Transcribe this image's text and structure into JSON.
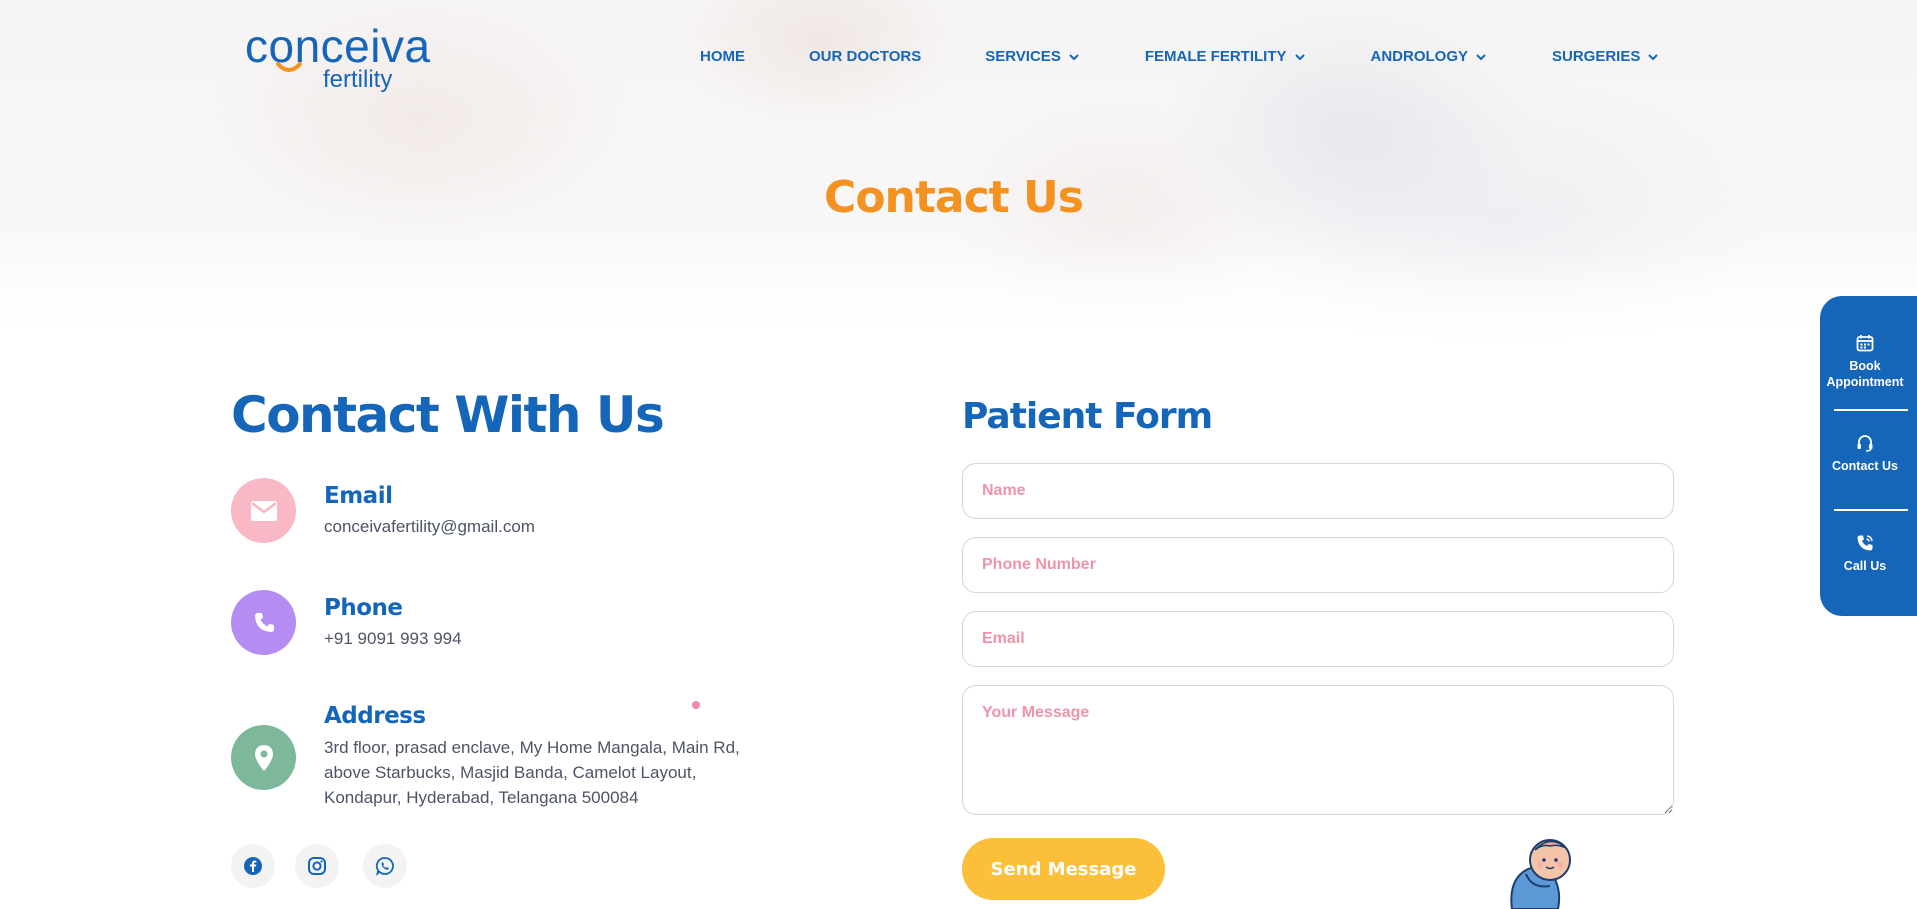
{
  "logo": {
    "main": "conceiva",
    "sub": "fertility"
  },
  "nav": {
    "items": [
      {
        "label": "HOME",
        "dropdown": false
      },
      {
        "label": "OUR DOCTORS",
        "dropdown": false
      },
      {
        "label": "SERVICES",
        "dropdown": true
      },
      {
        "label": "FEMALE FERTILITY",
        "dropdown": true
      },
      {
        "label": "ANDROLOGY",
        "dropdown": true
      },
      {
        "label": "SURGERIES",
        "dropdown": true
      }
    ]
  },
  "hero": {
    "title": "Contact Us"
  },
  "contact": {
    "title": "Contact With Us",
    "email": {
      "label": "Email",
      "value": "conceivafertility@gmail.com",
      "icon": "mail-icon"
    },
    "phone": {
      "label": "Phone",
      "value": "+91 9091 993 994",
      "icon": "phone-icon"
    },
    "address": {
      "label": "Address",
      "lines": [
        "3rd floor, prasad enclave, My Home Mangala, Main Rd,",
        "above Starbucks, Masjid Banda, Camelot Layout,",
        "Kondapur, Hyderabad, Telangana 500084"
      ],
      "icon": "location-pin-icon"
    },
    "socials": [
      "facebook-icon",
      "instagram-icon",
      "whatsapp-icon"
    ]
  },
  "form": {
    "title": "Patient Form",
    "name_placeholder": "Name",
    "phone_placeholder": "Phone Number",
    "email_placeholder": "Email",
    "message_placeholder": "Your Message",
    "submit_label": "Send Message"
  },
  "floating": {
    "book": "Book Appointment",
    "contact": "Contact Us",
    "call": "Call Us"
  },
  "colors": {
    "brand_blue": "#1565b8",
    "accent_orange": "#f49221",
    "button_yellow": "#fbbf3a",
    "email_icon_bg": "#f9b8c6",
    "phone_icon_bg": "#b48cf2",
    "address_icon_bg": "#7db89b"
  }
}
